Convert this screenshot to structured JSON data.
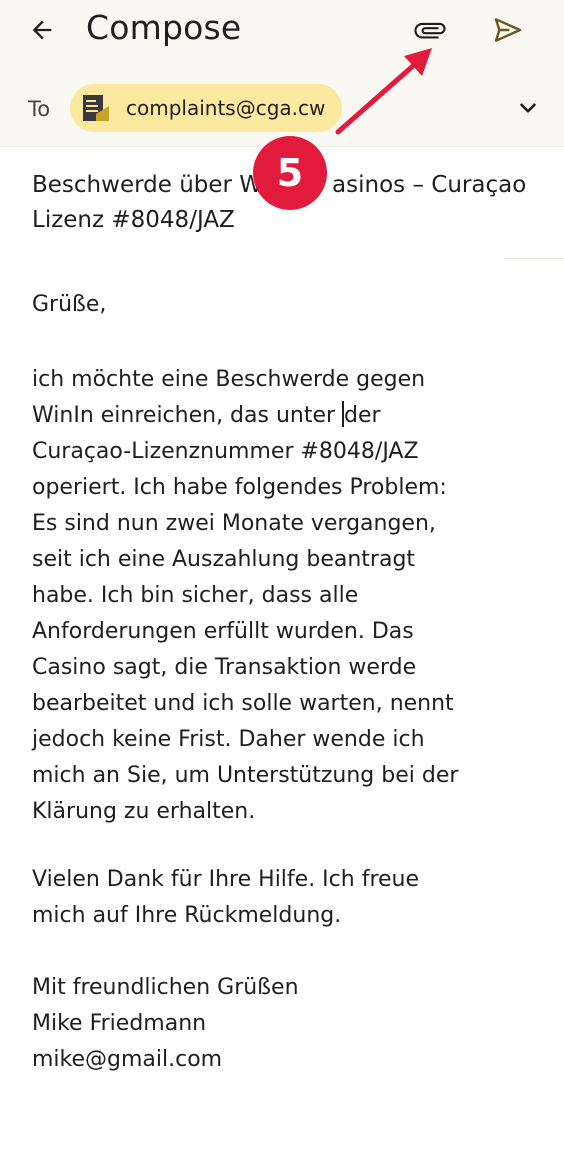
{
  "app_bar": {
    "title": "Compose",
    "back_icon": "arrow-left-icon",
    "attach_icon": "paperclip-icon",
    "send_icon": "send-icon"
  },
  "recipients": {
    "to_label": "To",
    "chip_email": "complaints@cga.cw",
    "chip_icon": "document-icon",
    "expand_icon": "chevron-down-icon"
  },
  "subject": {
    "line1_a": "Beschwerde über W",
    "line1_b": "asinos – Curaçao",
    "line2": "Lizenz #8048/JAZ"
  },
  "body": {
    "greeting": "Grüße,",
    "paragraph1": [
      "ich möchte eine Beschwerde gegen",
      "WinIn einreichen, das unter ",
      "der",
      "Curaçao-Lizenznummer #8048/JAZ",
      "operiert. Ich habe folgendes Problem:",
      "Es sind nun zwei Monate vergangen,",
      "seit ich eine Auszahlung beantragt",
      "habe. Ich bin sicher, dass alle",
      "Anforderungen erfüllt wurden. Das",
      "Casino sagt, die Transaktion werde",
      "bearbeitet und ich solle warten, nennt",
      "jedoch keine Frist. Daher wende ich",
      "mich an Sie, um Unterstützung bei der",
      "Klärung zu erhalten."
    ],
    "paragraph2": [
      "Vielen Dank für Ihre Hilfe. Ich freue",
      "mich auf Ihre Rückmeldung."
    ],
    "signature": [
      "Mit freundlichen Grüßen",
      "Mike Friedmann",
      "mike@gmail.com"
    ]
  },
  "annotation": {
    "step_number": "5",
    "color": "#e21b3c"
  },
  "colors": {
    "chip_background": "#fbe9a0",
    "app_bar_background": "#faf8f3",
    "send_icon": "#6b5a1e"
  }
}
